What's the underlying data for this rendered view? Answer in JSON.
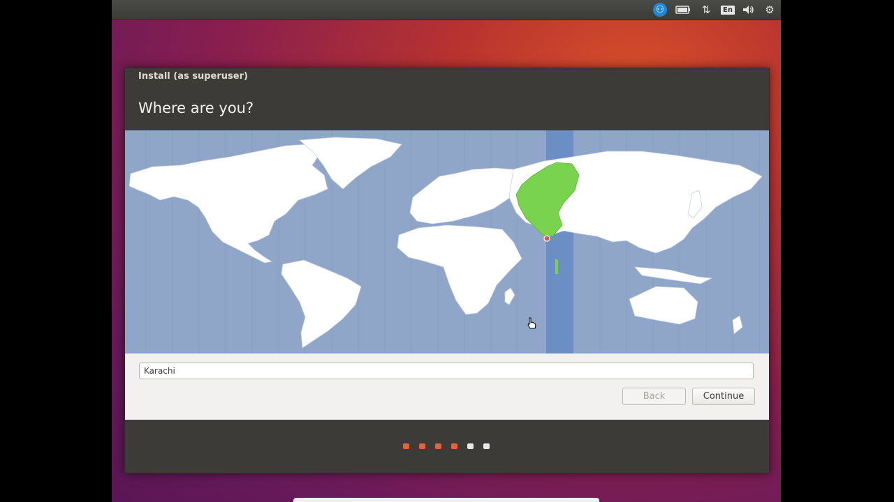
{
  "top_panel": {
    "icons": [
      "accessibility-icon",
      "battery-icon",
      "network-icon",
      "keyboard-layout-icon",
      "volume-icon",
      "settings-gear-icon"
    ],
    "keyboard_layout": "En"
  },
  "window": {
    "title": "Install (as superuser)",
    "heading": "Where are you?"
  },
  "map": {
    "selected_timezone": "Karachi",
    "highlight_color": "#7ad34f",
    "ocean_color": "#8fa6c9",
    "band_color": "#6b8fc4",
    "marker_color": "#e05a3a"
  },
  "location_input": {
    "value": "Karachi",
    "placeholder": ""
  },
  "buttons": {
    "back": "Back",
    "continue": "Continue"
  },
  "progress": {
    "total_steps": 6,
    "completed_steps": 4,
    "done_color": "#e0653a",
    "todo_color": "#e8e8e8"
  }
}
